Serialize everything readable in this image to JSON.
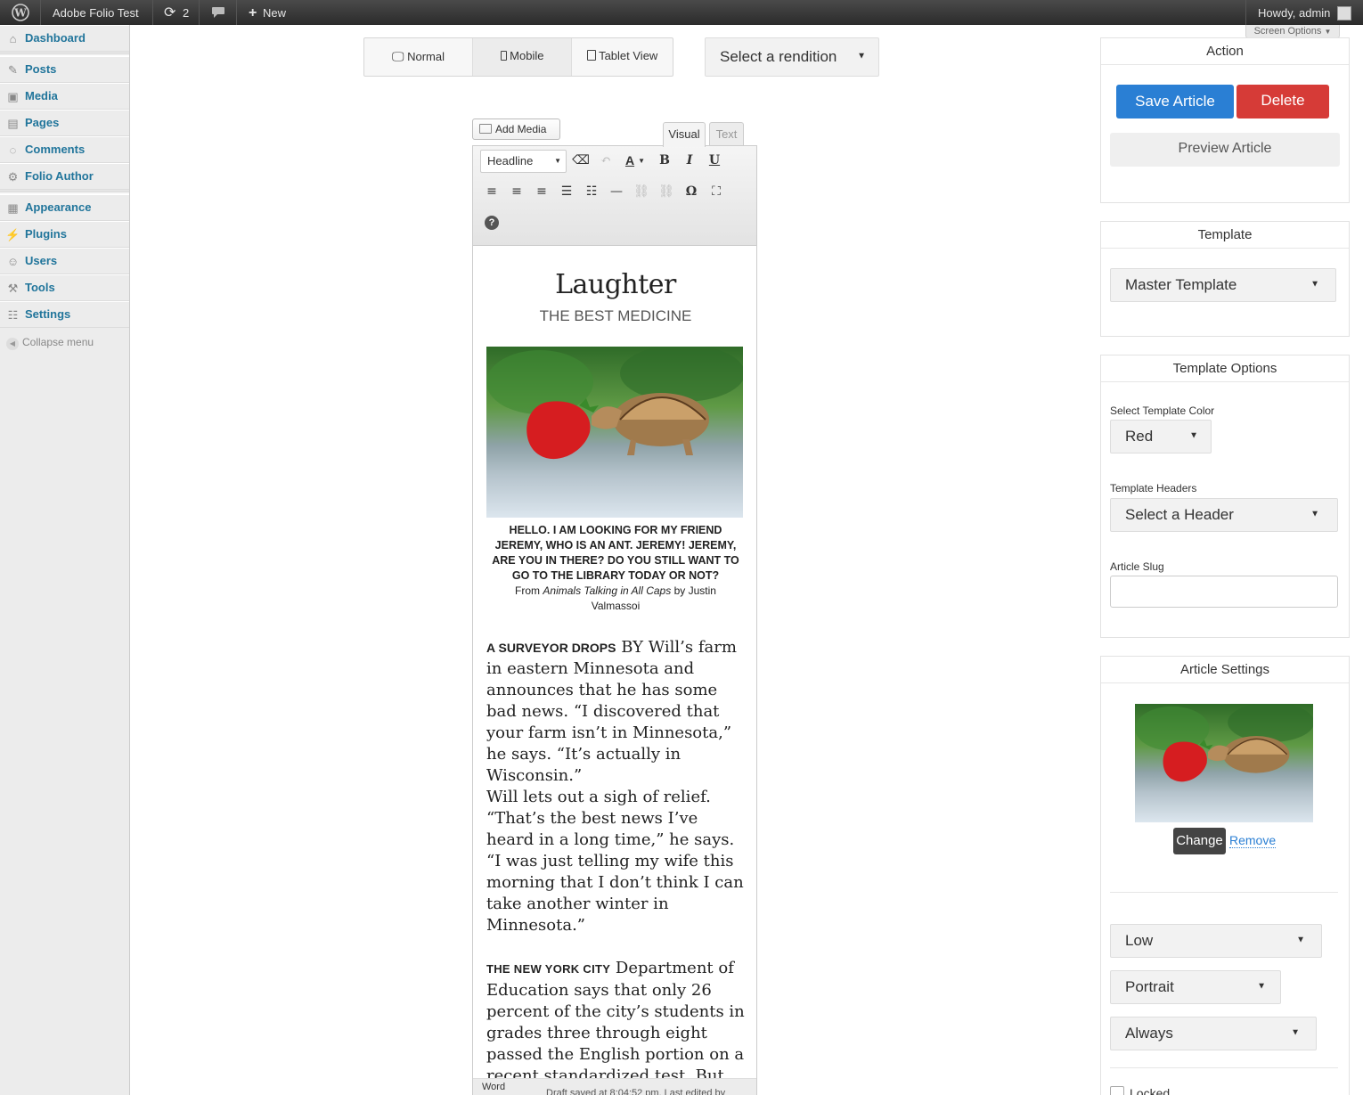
{
  "admin_bar": {
    "site_name": "Adobe Folio Test",
    "updates_count": "2",
    "new_label": "New",
    "howdy": "Howdy, admin",
    "screen_options": "Screen Options"
  },
  "sidebar": {
    "items": [
      {
        "label": "Dashboard",
        "icon": "home-icon"
      },
      {
        "label": "Posts",
        "icon": "pin-icon"
      },
      {
        "label": "Media",
        "icon": "media-icon"
      },
      {
        "label": "Pages",
        "icon": "page-icon"
      },
      {
        "label": "Comments",
        "icon": "comment-icon"
      },
      {
        "label": "Folio Author",
        "icon": "gear-icon"
      },
      {
        "label": "Appearance",
        "icon": "appearance-icon"
      },
      {
        "label": "Plugins",
        "icon": "plug-icon"
      },
      {
        "label": "Users",
        "icon": "users-icon"
      },
      {
        "label": "Tools",
        "icon": "tools-icon"
      },
      {
        "label": "Settings",
        "icon": "settings-icon"
      }
    ],
    "collapse_label": "Collapse menu"
  },
  "view_toggle": {
    "normal": "Normal",
    "mobile": "Mobile",
    "tablet": "Tablet View"
  },
  "rendition_select": "Select a rendition",
  "editor": {
    "add_media": "Add Media",
    "tab_visual": "Visual",
    "tab_text": "Text",
    "format_select": "Headline",
    "status_word": "Word",
    "status_saved": "Draft saved at 8:04:52 pm. Last edited by"
  },
  "article": {
    "title": "Laughter",
    "subtitle": "THE BEST MEDICINE",
    "caption": "HELLO. I AM LOOKING FOR MY FRIEND JEREMY, WHO IS AN ANT. JEREMY! JEREMY, ARE YOU IN THERE? DO YOU STILL WANT TO GO TO THE LIBRARY TODAY OR NOT?",
    "credit_from": "From",
    "credit_title": "Animals Talking in All Caps",
    "credit_by": "by Justin Valmassoi",
    "p1_lead": "A SURVEYOR DROPS",
    "p1_text": " BY Will’s farm in eastern Minnesota and announces that he has some bad news. “I discovered that your farm isn’t in Minnesota,” he says. “It’s actually in Wisconsin.”",
    "p2_text": "Will lets out a sigh of relief. “That’s the best news I’ve heard in a long time,” he says. “I was just telling my wife this morning that I don’t think I can take another winter in Minnesota.”",
    "p3_lead": "THE NEW YORK CITY",
    "p3_text": " Department of Education says that only 26 percent of the city’s students in grades three through eight passed the English portion on a recent standardized test. But on the bright side, they’re too bad at"
  },
  "action_panel": {
    "title": "Action",
    "save": "Save Article",
    "delete": "Delete",
    "preview": "Preview Article"
  },
  "template_panel": {
    "title": "Template",
    "selected": "Master Template"
  },
  "template_options": {
    "title": "Template Options",
    "color_label": "Select Template Color",
    "color_value": "Red",
    "headers_label": "Template Headers",
    "headers_value": "Select a Header",
    "slug_label": "Article Slug",
    "slug_value": ""
  },
  "article_settings": {
    "title": "Article Settings",
    "change": "Change",
    "remove": "Remove",
    "quality": "Low",
    "orientation": "Portrait",
    "frequency": "Always",
    "locked": "Locked"
  },
  "colors": {
    "primary": "#2a7fd4",
    "danger": "#d63b37",
    "link": "#21759b"
  }
}
